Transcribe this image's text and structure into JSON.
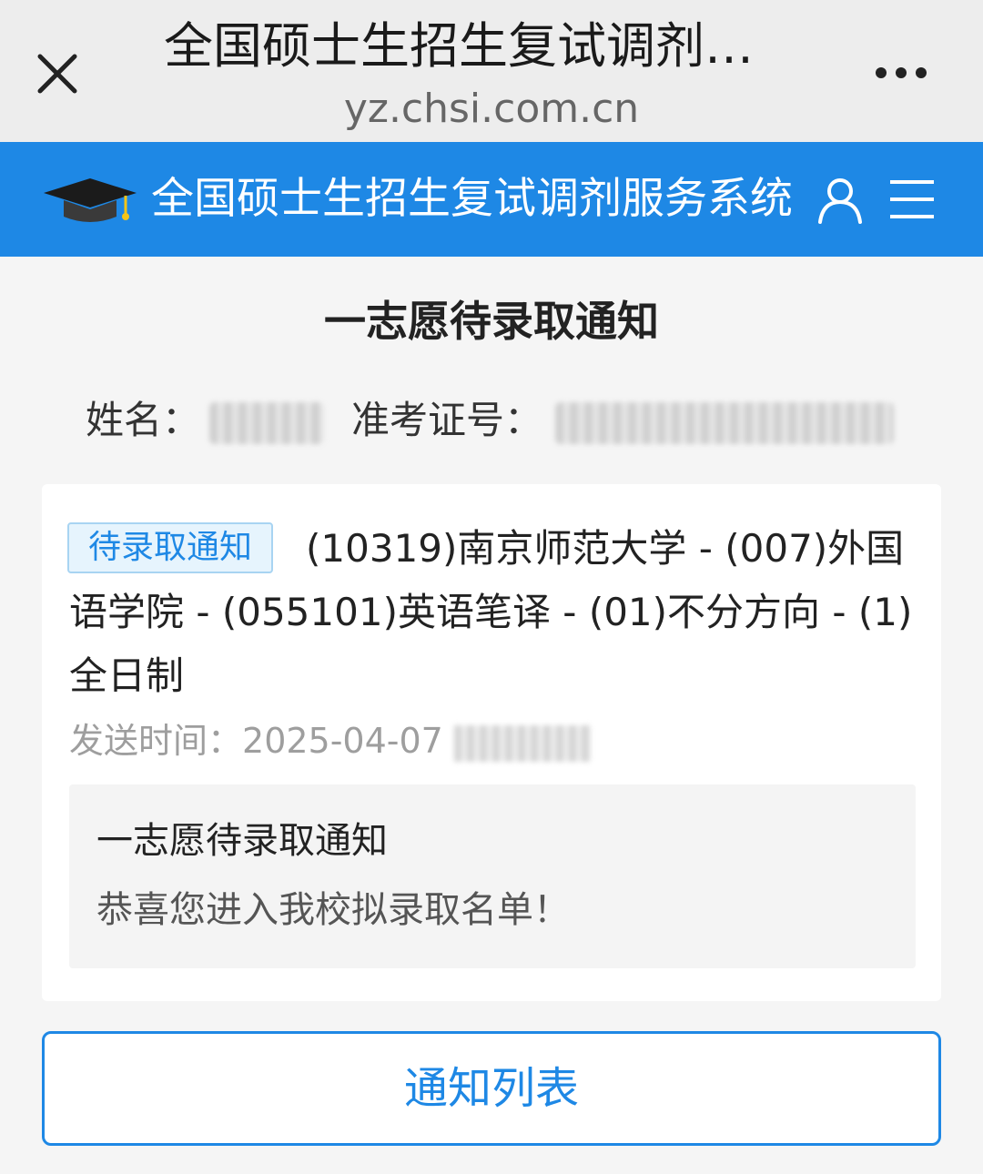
{
  "browser": {
    "title": "全国硕士生招生复试调剂…",
    "domain": "yz.chsi.com.cn",
    "close_icon": "close-icon",
    "more_icon": "more-dots-icon"
  },
  "header": {
    "site_title": "全国硕士生招生复试调剂服务系统",
    "logo_icon": "graduation-cap-icon",
    "user_icon": "user-icon",
    "menu_icon": "hamburger-menu-icon",
    "color": "#1e88e5"
  },
  "main": {
    "heading": "一志愿待录取通知",
    "name_label": "姓名：",
    "exam_number_label": "准考证号："
  },
  "notice": {
    "badge": "待录取通知",
    "program": "(10319)南京师范大学 - (007)外国语学院 - (055101)英语笔译 - (01)不分方向 - (1)全日制",
    "sent_time_label": "发送时间：",
    "sent_date": "2025-04-07",
    "message_title": "一志愿待录取通知",
    "message_body": "恭喜您进入我校拟录取名单！"
  },
  "footer": {
    "list_button": "通知列表"
  }
}
